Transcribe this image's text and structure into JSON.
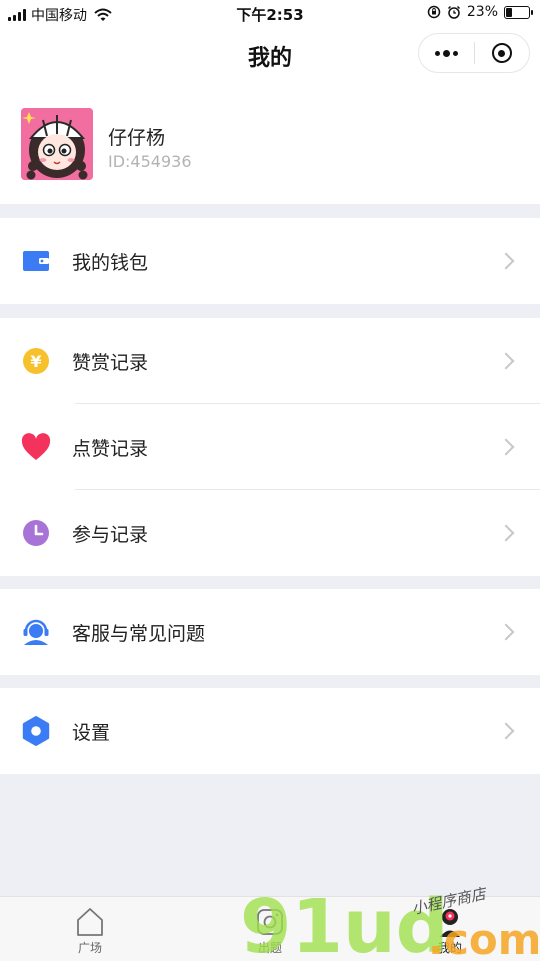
{
  "status_bar": {
    "carrier": "中国移动",
    "time": "下午2:53",
    "battery_percent": "23%",
    "battery_level": 0.23
  },
  "nav": {
    "title": "我的"
  },
  "profile": {
    "name": "仔仔杨",
    "id": "ID:454936"
  },
  "menu": {
    "wallet": {
      "label": "我的钱包",
      "icon": "wallet-icon",
      "color": "#3b7cf5"
    },
    "rewards": {
      "label": "赞赏记录",
      "icon": "yen-coin-icon",
      "color": "#f7c12d"
    },
    "likes": {
      "label": "点赞记录",
      "icon": "heart-icon",
      "color": "#f4335c"
    },
    "participation": {
      "label": "参与记录",
      "icon": "clock-icon",
      "color": "#a873d6"
    },
    "support": {
      "label": "客服与常见问题",
      "icon": "headset-icon",
      "color": "#3b7cf5"
    },
    "settings": {
      "label": "设置",
      "icon": "gear-icon",
      "color": "#3b7cf5"
    }
  },
  "tabs": [
    {
      "label": "广场",
      "icon": "home-icon"
    },
    {
      "label": "出题",
      "icon": "camera-icon"
    },
    {
      "label": "我的",
      "icon": "profile-icon",
      "active": true
    }
  ],
  "watermark": {
    "brand": "91ud",
    "domain": ".com",
    "tagline": "小程序商店"
  }
}
